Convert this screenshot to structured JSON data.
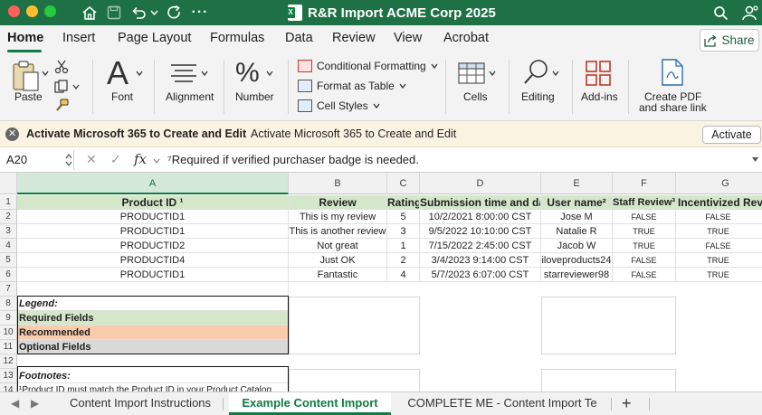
{
  "window": {
    "title": "R&R Import ACME Corp 2025"
  },
  "ribbon_tabs": [
    "Home",
    "Insert",
    "Page Layout",
    "Formulas",
    "Data",
    "Review",
    "View",
    "Acrobat"
  ],
  "share_label": "Share",
  "ribbon": {
    "paste": "Paste",
    "font": "Font",
    "alignment": "Alignment",
    "number": "Number",
    "conditional_formatting": "Conditional Formatting",
    "format_as_table": "Format as Table",
    "cell_styles": "Cell Styles",
    "cells": "Cells",
    "editing": "Editing",
    "addins": "Add-ins",
    "create_pdf_line1": "Create PDF",
    "create_pdf_line2": "and share link"
  },
  "activation": {
    "title": "Activate Microsoft 365 to Create and Edit",
    "message": "Activate Microsoft 365 to Create and Edit",
    "button": "Activate"
  },
  "formula_bar": {
    "cell_ref": "A20",
    "formula": "⁷Required if verified purchaser badge is needed."
  },
  "columns": [
    "A",
    "B",
    "C",
    "D",
    "E",
    "F",
    "G"
  ],
  "rows": [
    "1",
    "2",
    "3",
    "4",
    "5",
    "6",
    "7",
    "8",
    "9",
    "10",
    "11",
    "12",
    "13",
    "14"
  ],
  "table": {
    "headers": [
      "Product ID ¹",
      "Review",
      "Rating",
      "Submission time and date",
      "User name²",
      "Staff Review³",
      "Incentivized Review"
    ],
    "data": [
      [
        "PRODUCTID1",
        "This is my review",
        "5",
        "10/2/2021 8:00:00 CST",
        "Jose M",
        "FALSE",
        "FALSE"
      ],
      [
        "PRODUCTID1",
        "This is another review",
        "3",
        "9/5/2022 10:10:00 CST",
        "Natalie R",
        "TRUE",
        "TRUE"
      ],
      [
        "PRODUCTID2",
        "Not great",
        "1",
        "7/15/2022 2:45:00 CST",
        "Jacob W",
        "TRUE",
        "FALSE"
      ],
      [
        "PRODUCTID4",
        "Just OK",
        "2",
        "3/4/2023 9:14:00 CST",
        "iloveproducts24",
        "FALSE",
        "TRUE"
      ],
      [
        "PRODUCTID1",
        "Fantastic",
        "4",
        "5/7/2023 6:07:00 CST",
        "starreviewer98",
        "FALSE",
        "TRUE"
      ]
    ]
  },
  "legend": {
    "title": "Legend:",
    "required": "Required Fields",
    "recommended": "Recommended",
    "optional": "Optional Fields"
  },
  "footnotes": {
    "title": "Footnotes:",
    "line1": "¹Product ID must match the Product ID in your Product Catalog"
  },
  "sheet_tabs": [
    "Content Import Instructions",
    "Example Content Import",
    "COMPLETE ME - Content Import Te"
  ],
  "colors": {
    "title_bar": "#1e7145",
    "required": "#d4e7c9",
    "recommended": "#f8ccad",
    "optional": "#d9d9d9",
    "accent": "#107c41"
  }
}
